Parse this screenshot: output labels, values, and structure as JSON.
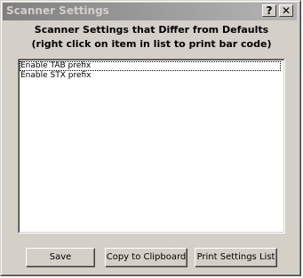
{
  "window": {
    "title": "Scanner Settings",
    "help_glyph": "?",
    "close_glyph": "✕"
  },
  "header": {
    "line1": "Scanner Settings that Differ from Defaults",
    "line2": "(right click on item in list to print bar code)"
  },
  "settings_list": {
    "items": [
      {
        "label": "Enable TAB prefix"
      },
      {
        "label": "Enable STX prefix"
      }
    ]
  },
  "buttons": {
    "save": "Save",
    "copy": "Copy to Clipboard",
    "print": "Print Settings List"
  },
  "colors": {
    "window_face": "#d4d0c8",
    "titlebar_start": "#808080",
    "titlebar_end": "#b5b5b5"
  },
  "icons": {
    "help": "question-mark-icon",
    "close": "close-icon"
  }
}
